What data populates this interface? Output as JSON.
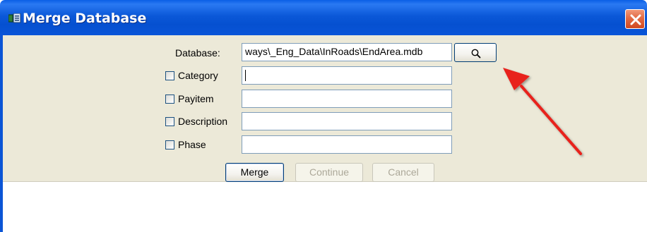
{
  "window": {
    "title": "Merge Database",
    "icon": "app-icon",
    "close_icon": "close-icon"
  },
  "form": {
    "database_label": "Database:",
    "database_value": "ways\\_Eng_Data\\InRoads\\EndArea.mdb",
    "browse_icon": "search-icon",
    "fields": [
      {
        "label": "Category",
        "value": "",
        "checked": false
      },
      {
        "label": "Payitem",
        "value": "",
        "checked": false
      },
      {
        "label": "Description",
        "value": "",
        "checked": false
      },
      {
        "label": "Phase",
        "value": "",
        "checked": false
      }
    ]
  },
  "buttons": {
    "merge": "Merge",
    "continue": "Continue",
    "cancel": "Cancel"
  },
  "annotation": {
    "arrow_color": "#e8231c"
  }
}
